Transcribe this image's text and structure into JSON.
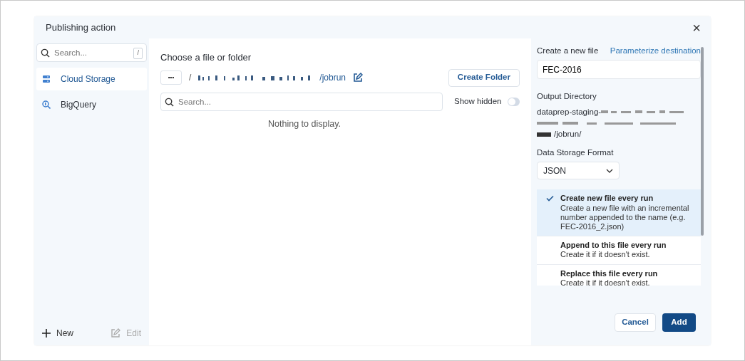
{
  "dialog": {
    "title": "Publishing action",
    "close": "×"
  },
  "sidebar": {
    "search": {
      "placeholder": "Search...",
      "shortcut": "/"
    },
    "items": [
      {
        "label": "Cloud Storage",
        "kind": "storage",
        "selected": true
      },
      {
        "label": "BigQuery",
        "kind": "query",
        "selected": false
      }
    ],
    "new_label": "New",
    "edit": {
      "label": "Edit",
      "disabled": true
    }
  },
  "browser": {
    "heading": "Choose a file or folder",
    "more": "•••",
    "path_prefix": "/",
    "path_end": "/jobrun",
    "create_folder": "Create Folder",
    "search": {
      "placeholder": "Search..."
    },
    "show_hidden": {
      "label": "Show hidden",
      "on": false
    },
    "empty": "Nothing to display."
  },
  "settings": {
    "file_label": "Create a new file",
    "parameterize": "Parameterize destination",
    "file_name": "FEC-2016",
    "output_label": "Output Directory",
    "output_start": "dataprep-staging-",
    "output_end": "/jobrun/",
    "format_label": "Data Storage Format",
    "format": "JSON",
    "options": [
      {
        "title": "Create new file every run",
        "description": "Create a new file with an incremental number appended to the name (e.g. FEC-2016_2.json)",
        "selected": true
      },
      {
        "title": "Append to this file every run",
        "description": "Create it if it doesn't exist.",
        "selected": false
      },
      {
        "title": "Replace this file every run",
        "description": "Create it if it doesn't exist.",
        "selected": false
      }
    ]
  },
  "buttons": {
    "cancel": "Cancel",
    "add": "Add"
  }
}
